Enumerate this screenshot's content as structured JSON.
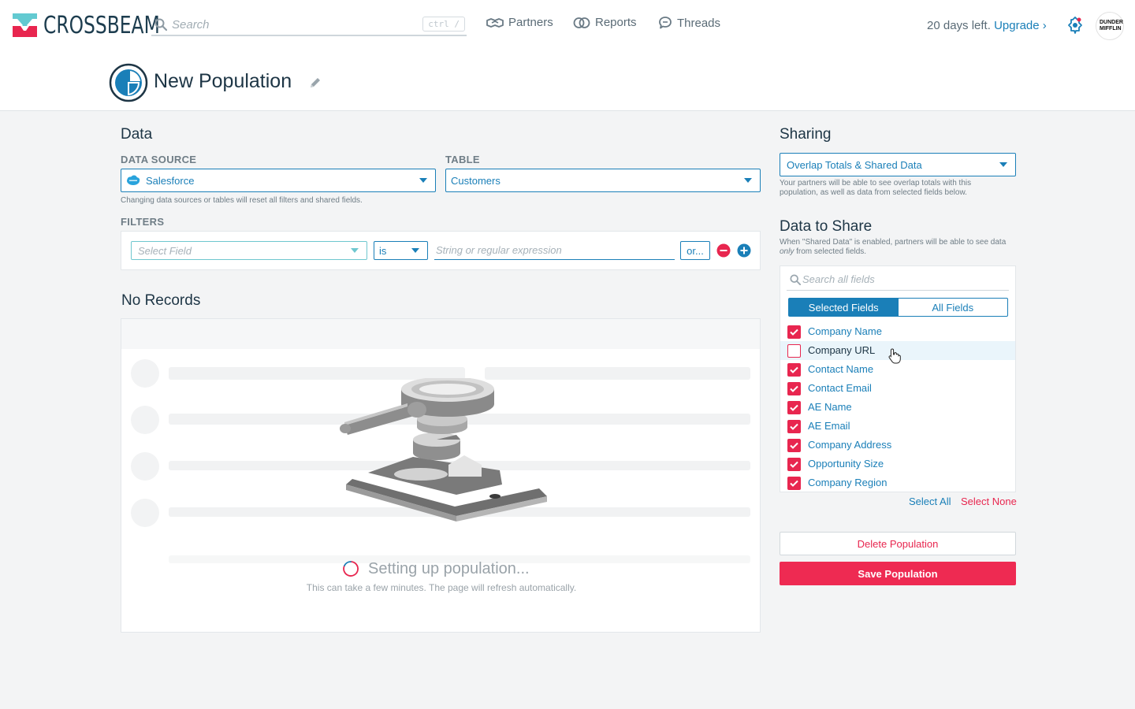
{
  "app": {
    "brand": "CROSSBEAM"
  },
  "header": {
    "search_placeholder": "Search",
    "search_shortcut": "ctrl /",
    "nav": [
      {
        "label": "Partners",
        "icon": "handshake-icon"
      },
      {
        "label": "Reports",
        "icon": "overlap-circles-icon"
      },
      {
        "label": "Threads",
        "icon": "chat-bubble-icon"
      }
    ],
    "trial_text": "20 days left.",
    "upgrade_label": "Upgrade ›",
    "avatar_text": "DUNDER MIFFLIN"
  },
  "page": {
    "title": "New Population"
  },
  "data_section": {
    "heading": "Data",
    "data_source_label": "DATA SOURCE",
    "data_source_value": "Salesforce",
    "table_label": "TABLE",
    "table_value": "Customers",
    "hint": "Changing data sources or tables will reset all filters and shared fields.",
    "filters_label": "FILTERS",
    "filter": {
      "field_placeholder": "Select Field",
      "operator": "is",
      "value_placeholder": "String or regular expression",
      "or_label": "or..."
    }
  },
  "records": {
    "heading": "No Records",
    "status": "Setting up population...",
    "sub": "This can take a few minutes. The page will refresh automatically."
  },
  "sharing": {
    "heading": "Sharing",
    "selected": "Overlap Totals & Shared Data",
    "hint": "Your partners will be able to see overlap totals with this population, as well as data from selected fields below.",
    "share_heading": "Data to Share",
    "share_hint_pre": "When \"Shared Data\" is enabled, partners will be able to see data ",
    "share_hint_em": "only",
    "share_hint_post": " from selected fields.",
    "search_placeholder": "Search all fields",
    "tabs": [
      "Selected Fields",
      "All Fields"
    ],
    "fields": [
      {
        "label": "Company Name",
        "checked": true
      },
      {
        "label": "Company URL",
        "checked": false
      },
      {
        "label": "Contact Name",
        "checked": true
      },
      {
        "label": "Contact Email",
        "checked": true
      },
      {
        "label": "AE Name",
        "checked": true
      },
      {
        "label": "AE Email",
        "checked": true
      },
      {
        "label": "Company Address",
        "checked": true
      },
      {
        "label": "Opportunity Size",
        "checked": true
      },
      {
        "label": "Company Region",
        "checked": true
      }
    ],
    "select_all": "Select All",
    "select_none": "Select None"
  },
  "actions": {
    "delete": "Delete Population",
    "save": "Save Population"
  },
  "colors": {
    "accent": "#1a7fb8",
    "danger": "#ee2a52",
    "ink": "#1d3545"
  }
}
